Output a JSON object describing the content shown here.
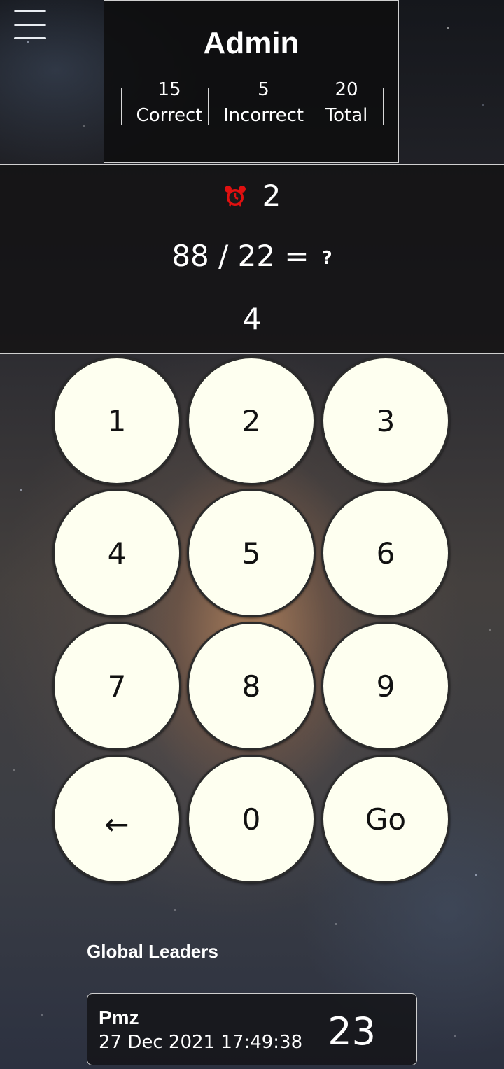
{
  "header": {
    "user_name": "Admin",
    "stats": [
      {
        "value": "15",
        "label": "Correct"
      },
      {
        "value": "5",
        "label": "Incorrect"
      },
      {
        "value": "20",
        "label": "Total"
      }
    ]
  },
  "question": {
    "timer_icon": "alarm-clock-icon",
    "timer_color": "#e01010",
    "timer_value": "2",
    "equation": "88 / 22 =",
    "placeholder": "?",
    "answer": "4"
  },
  "keypad": {
    "keys": [
      "1",
      "2",
      "3",
      "4",
      "5",
      "6",
      "7",
      "8",
      "9",
      "←",
      "0",
      "Go"
    ]
  },
  "leaders": {
    "title": "Global Leaders",
    "entries": [
      {
        "name": "Pmz",
        "date": "27 Dec 2021 17:49:38",
        "score": "23"
      }
    ]
  }
}
